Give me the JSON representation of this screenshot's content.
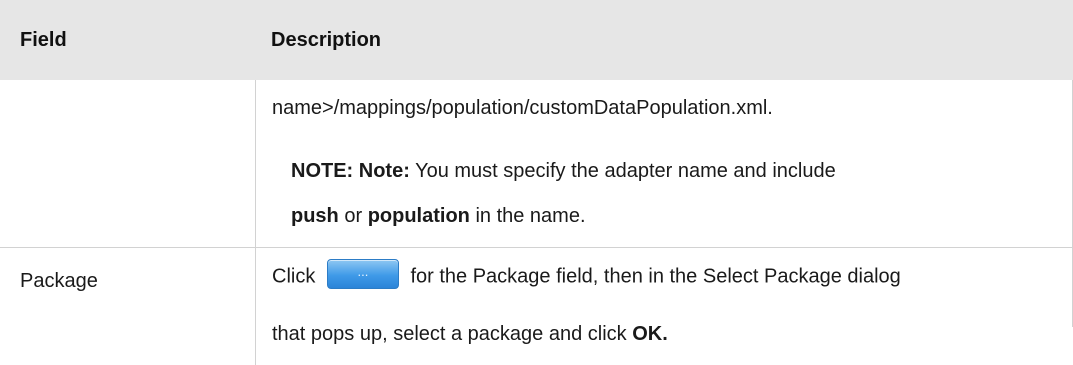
{
  "table": {
    "headers": {
      "field": "Field",
      "description": "Description"
    },
    "row1": {
      "field": "",
      "path_text": "name>/mappings/population/customDataPopulation.xml.",
      "note_label": "NOTE: Note:",
      "note_text": " You must specify the adapter name and include",
      "note_bold1": "push",
      "note_mid": " or ",
      "note_bold2": "population",
      "note_end": " in the name."
    },
    "row2": {
      "field": "Package",
      "click_text": "Click ",
      "button_label": "...",
      "after_button": " for the Package field, then in the Select Package dialog",
      "line2_text": "that pops up, select a package and click ",
      "ok_label": "OK."
    }
  },
  "colors": {
    "header_bg": "#e6e6e6",
    "border": "#d2d2d2",
    "button_blue": "#3f9ae8"
  },
  "icons": {
    "browse": "ellipsis-button"
  }
}
